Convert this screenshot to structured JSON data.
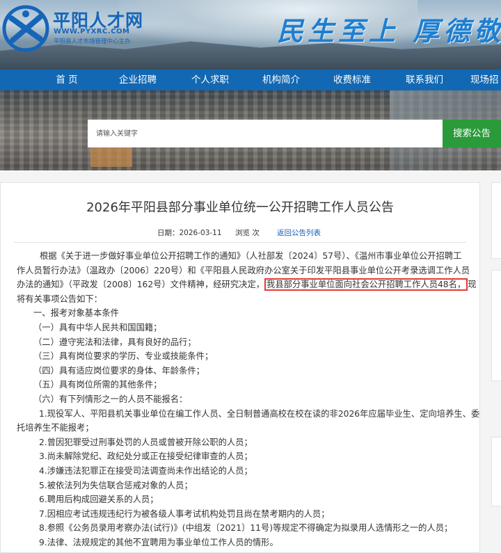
{
  "header": {
    "site_name": "平阳人才网",
    "site_url": "WWW.PYXRC.COM",
    "site_sub": "平阳县人才市场管理中心主办",
    "slogan": "民生至上 厚德敬業"
  },
  "nav": {
    "items": [
      "首 页",
      "企业招聘",
      "个人求职",
      "机构简介",
      "收费标准",
      "联系我们",
      "现场招"
    ]
  },
  "search": {
    "placeholder": "请输入关键字",
    "button": "搜索公告"
  },
  "article": {
    "title": "2026年平阳县部分事业单位统一公开招聘工作人员公告",
    "date_label": "日期：2026-03-11",
    "views_label": "浏览 次",
    "back_link": "返回公告列表",
    "intro_line1": "根据《关于进一步做好事业单位公开招聘工作的通知》（人社部发〔2024〕57号）、《温州市事业单位公开招聘工",
    "intro_line2": "作人员暂行办法》（温政办〔2006〕220号）和《平阳县人民政府办公室关于印发平阳县事业单位公开考录选调工作人员",
    "intro_line3_pre": "办法的通知》（平政发〔2008〕162号）文件精神，经研究决定，",
    "intro_highlight": "我县部分事业单位面向社会公开招聘工作人员48名，",
    "intro_line3_post": "现",
    "intro_line4": "将有关事项公告如下：",
    "section1": "一、报考对象基本条件",
    "cond1": "（一）具有中华人民共和国国籍；",
    "cond2": "（二）遵守宪法和法律，具有良好的品行；",
    "cond3": "（三）具有岗位要求的学历、专业或技能条件；",
    "cond4": "（四）具有适应岗位要求的身体、年龄条件；",
    "cond5": "（五）具有岗位所需的其他条件；",
    "cond6": "（六）有下列情形之一的人员不能报名：",
    "excl1_a": "1.现役军人、平阳县机关事业单位在编工作人员、全日制普通高校在校在读的非2026年应届毕业生、定向培养生、委",
    "excl1_b": "托培养生不能报考；",
    "excl2": "2.曾因犯罪受过刑事处罚的人员或曾被开除公职的人员；",
    "excl3": "3.尚未解除党纪、政纪处分或正在接受纪律审查的人员；",
    "excl4": "4.涉嫌违法犯罪正在接受司法调查尚未作出结论的人员；",
    "excl5": "5.被依法列为失信联合惩戒对象的人员；",
    "excl6": "6.聘用后构成回避关系的人员；",
    "excl7": "7.因相应考试违规违纪行为被各级人事考试机构处罚且尚在禁考期内的人员；",
    "excl8": "8.参照《公务员录用考察办法(试行)》(中组发〔2021〕11号)等规定不得确定为拟录用人选情形之一的人员；",
    "excl9": "9.法律、法规规定的其他不宜聘用为事业单位工作人员的情形。"
  }
}
